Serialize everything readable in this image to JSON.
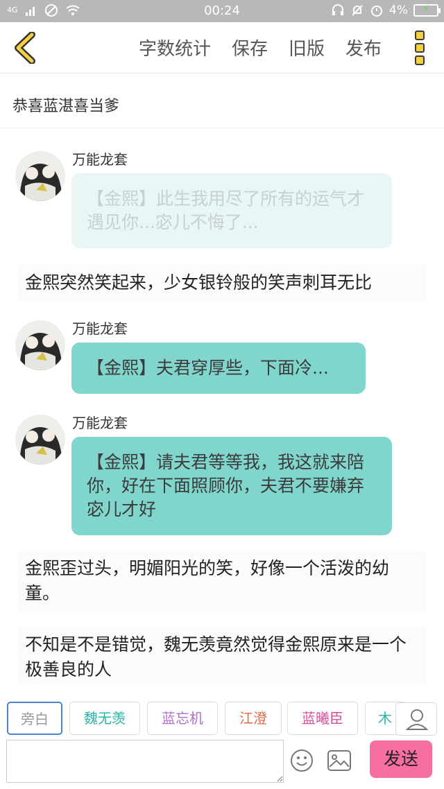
{
  "status_bar": {
    "time": "00:24",
    "battery": "4%",
    "network": "4G"
  },
  "header": {
    "actions": [
      "字数统计",
      "保存",
      "旧版",
      "发布"
    ]
  },
  "document": {
    "title": "恭喜蓝湛喜当爹"
  },
  "messages": [
    {
      "type": "dialog",
      "author": "万能龙套",
      "text": "【金熙】此生我用尽了所有的运气才遇见你...宓儿不悔了...",
      "style": "faded"
    },
    {
      "type": "narration",
      "text": "金熙突然笑起来，少女银铃般的笑声刺耳无比"
    },
    {
      "type": "dialog",
      "author": "万能龙套",
      "text": "【金熙】夫君穿厚些，下面冷...",
      "style": "teal"
    },
    {
      "type": "dialog",
      "author": "万能龙套",
      "text": "【金熙】请夫君等等我，我这就来陪你，好在下面照顾你，夫君不要嫌弃宓儿才好",
      "style": "teal"
    },
    {
      "type": "narration",
      "text": "金熙歪过头，明媚阳光的笑，好像一个活泼的幼童。"
    },
    {
      "type": "narration",
      "text": "不知是不是错觉，魏无羡竟然觉得金熙原来是一个极善良的人"
    }
  ],
  "character_chips": [
    {
      "label": "旁白",
      "color": "#999999",
      "active": true
    },
    {
      "label": "魏无羡",
      "color": "#2bb5a8",
      "active": false
    },
    {
      "label": "蓝忘机",
      "color": "#b070c9",
      "active": false
    },
    {
      "label": "江澄",
      "color": "#e46a4a",
      "active": false
    },
    {
      "label": "蓝曦臣",
      "color": "#d64f9a",
      "active": false
    },
    {
      "label": "木",
      "color": "#2bb5a8",
      "active": false
    }
  ],
  "composer": {
    "input_value": "",
    "send_label": "发送"
  },
  "icons": {
    "back": "chevron-left-icon",
    "more": "more-vertical-icon",
    "person": "person-icon",
    "emoji": "emoji-icon",
    "image": "image-icon"
  },
  "colors": {
    "teal_bubble": "#80d6cc",
    "faded_bubble": "#e8f7f6",
    "send": "#f76fa0",
    "accent_yellow": "#f5d142"
  }
}
